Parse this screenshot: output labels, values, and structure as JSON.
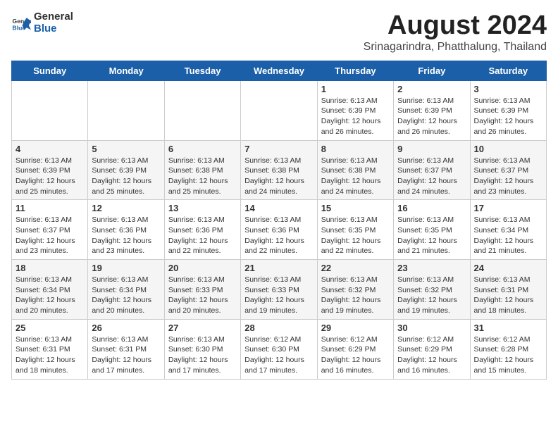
{
  "logo": {
    "general": "General",
    "blue": "Blue"
  },
  "title": {
    "month_year": "August 2024",
    "location": "Srinagarindra, Phatthalung, Thailand"
  },
  "headers": [
    "Sunday",
    "Monday",
    "Tuesday",
    "Wednesday",
    "Thursday",
    "Friday",
    "Saturday"
  ],
  "weeks": [
    [
      {
        "day": "",
        "detail": ""
      },
      {
        "day": "",
        "detail": ""
      },
      {
        "day": "",
        "detail": ""
      },
      {
        "day": "",
        "detail": ""
      },
      {
        "day": "1",
        "detail": "Sunrise: 6:13 AM\nSunset: 6:39 PM\nDaylight: 12 hours\nand 26 minutes."
      },
      {
        "day": "2",
        "detail": "Sunrise: 6:13 AM\nSunset: 6:39 PM\nDaylight: 12 hours\nand 26 minutes."
      },
      {
        "day": "3",
        "detail": "Sunrise: 6:13 AM\nSunset: 6:39 PM\nDaylight: 12 hours\nand 26 minutes."
      }
    ],
    [
      {
        "day": "4",
        "detail": "Sunrise: 6:13 AM\nSunset: 6:39 PM\nDaylight: 12 hours\nand 25 minutes."
      },
      {
        "day": "5",
        "detail": "Sunrise: 6:13 AM\nSunset: 6:39 PM\nDaylight: 12 hours\nand 25 minutes."
      },
      {
        "day": "6",
        "detail": "Sunrise: 6:13 AM\nSunset: 6:38 PM\nDaylight: 12 hours\nand 25 minutes."
      },
      {
        "day": "7",
        "detail": "Sunrise: 6:13 AM\nSunset: 6:38 PM\nDaylight: 12 hours\nand 24 minutes."
      },
      {
        "day": "8",
        "detail": "Sunrise: 6:13 AM\nSunset: 6:38 PM\nDaylight: 12 hours\nand 24 minutes."
      },
      {
        "day": "9",
        "detail": "Sunrise: 6:13 AM\nSunset: 6:37 PM\nDaylight: 12 hours\nand 24 minutes."
      },
      {
        "day": "10",
        "detail": "Sunrise: 6:13 AM\nSunset: 6:37 PM\nDaylight: 12 hours\nand 23 minutes."
      }
    ],
    [
      {
        "day": "11",
        "detail": "Sunrise: 6:13 AM\nSunset: 6:37 PM\nDaylight: 12 hours\nand 23 minutes."
      },
      {
        "day": "12",
        "detail": "Sunrise: 6:13 AM\nSunset: 6:36 PM\nDaylight: 12 hours\nand 23 minutes."
      },
      {
        "day": "13",
        "detail": "Sunrise: 6:13 AM\nSunset: 6:36 PM\nDaylight: 12 hours\nand 22 minutes."
      },
      {
        "day": "14",
        "detail": "Sunrise: 6:13 AM\nSunset: 6:36 PM\nDaylight: 12 hours\nand 22 minutes."
      },
      {
        "day": "15",
        "detail": "Sunrise: 6:13 AM\nSunset: 6:35 PM\nDaylight: 12 hours\nand 22 minutes."
      },
      {
        "day": "16",
        "detail": "Sunrise: 6:13 AM\nSunset: 6:35 PM\nDaylight: 12 hours\nand 21 minutes."
      },
      {
        "day": "17",
        "detail": "Sunrise: 6:13 AM\nSunset: 6:34 PM\nDaylight: 12 hours\nand 21 minutes."
      }
    ],
    [
      {
        "day": "18",
        "detail": "Sunrise: 6:13 AM\nSunset: 6:34 PM\nDaylight: 12 hours\nand 20 minutes."
      },
      {
        "day": "19",
        "detail": "Sunrise: 6:13 AM\nSunset: 6:34 PM\nDaylight: 12 hours\nand 20 minutes."
      },
      {
        "day": "20",
        "detail": "Sunrise: 6:13 AM\nSunset: 6:33 PM\nDaylight: 12 hours\nand 20 minutes."
      },
      {
        "day": "21",
        "detail": "Sunrise: 6:13 AM\nSunset: 6:33 PM\nDaylight: 12 hours\nand 19 minutes."
      },
      {
        "day": "22",
        "detail": "Sunrise: 6:13 AM\nSunset: 6:32 PM\nDaylight: 12 hours\nand 19 minutes."
      },
      {
        "day": "23",
        "detail": "Sunrise: 6:13 AM\nSunset: 6:32 PM\nDaylight: 12 hours\nand 19 minutes."
      },
      {
        "day": "24",
        "detail": "Sunrise: 6:13 AM\nSunset: 6:31 PM\nDaylight: 12 hours\nand 18 minutes."
      }
    ],
    [
      {
        "day": "25",
        "detail": "Sunrise: 6:13 AM\nSunset: 6:31 PM\nDaylight: 12 hours\nand 18 minutes."
      },
      {
        "day": "26",
        "detail": "Sunrise: 6:13 AM\nSunset: 6:31 PM\nDaylight: 12 hours\nand 17 minutes."
      },
      {
        "day": "27",
        "detail": "Sunrise: 6:13 AM\nSunset: 6:30 PM\nDaylight: 12 hours\nand 17 minutes."
      },
      {
        "day": "28",
        "detail": "Sunrise: 6:12 AM\nSunset: 6:30 PM\nDaylight: 12 hours\nand 17 minutes."
      },
      {
        "day": "29",
        "detail": "Sunrise: 6:12 AM\nSunset: 6:29 PM\nDaylight: 12 hours\nand 16 minutes."
      },
      {
        "day": "30",
        "detail": "Sunrise: 6:12 AM\nSunset: 6:29 PM\nDaylight: 12 hours\nand 16 minutes."
      },
      {
        "day": "31",
        "detail": "Sunrise: 6:12 AM\nSunset: 6:28 PM\nDaylight: 12 hours\nand 15 minutes."
      }
    ]
  ]
}
